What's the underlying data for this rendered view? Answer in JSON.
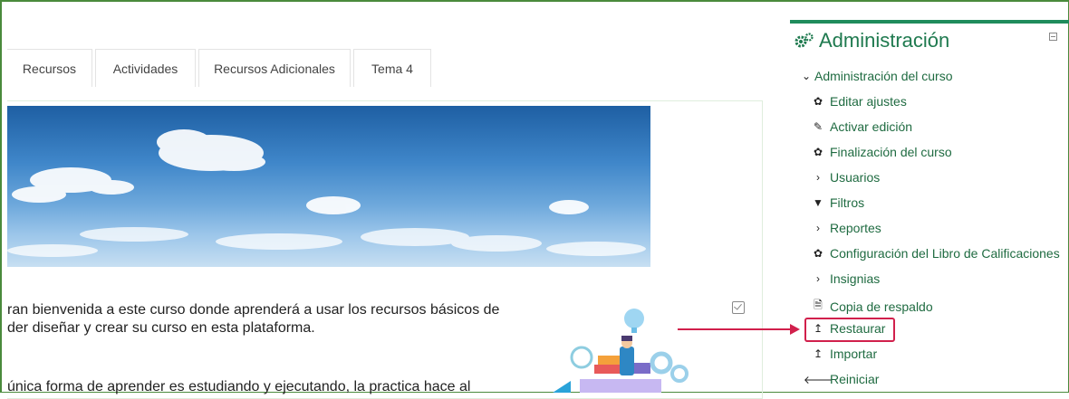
{
  "tabs": [
    {
      "label": "Recursos"
    },
    {
      "label": "Actividades"
    },
    {
      "label": "Recursos Adicionales"
    },
    {
      "label": "Tema 4"
    }
  ],
  "content": {
    "intro_line1": "ran bienvenida a este curso donde aprenderá a usar los recursos básicos de",
    "intro_line2": "der diseñar y crear su curso en esta plataforma.",
    "outro_line": "única forma de aprender es estudiando y ejecutando, la practica hace al"
  },
  "sidebar": {
    "title": "Administración",
    "title_icon": "gears-icon",
    "accent_color": "#1f8c5c",
    "items": [
      {
        "label": "Administración del curso",
        "icon": "chevron-down-icon"
      },
      {
        "label": "Editar ajustes",
        "icon": "gear-icon"
      },
      {
        "label": "Activar edición",
        "icon": "pencil-icon"
      },
      {
        "label": "Finalización del curso",
        "icon": "gear-icon"
      },
      {
        "label": "Usuarios",
        "icon": "chevron-right-icon"
      },
      {
        "label": "Filtros",
        "icon": "filter-icon"
      },
      {
        "label": "Reportes",
        "icon": "chevron-right-icon"
      },
      {
        "label": "Configuración del Libro de Calificaciones",
        "icon": "gear-icon"
      },
      {
        "label": "Insignias",
        "icon": "chevron-right-icon"
      },
      {
        "label": "Copia de respaldo",
        "icon": "file-archive-icon"
      },
      {
        "label": "Restaurar",
        "icon": "upload-icon"
      },
      {
        "label": "Importar",
        "icon": "upload-icon"
      },
      {
        "label": "Reiniciar",
        "icon": "arrow-left-icon"
      }
    ]
  },
  "highlight": {
    "color": "#d1204c"
  }
}
